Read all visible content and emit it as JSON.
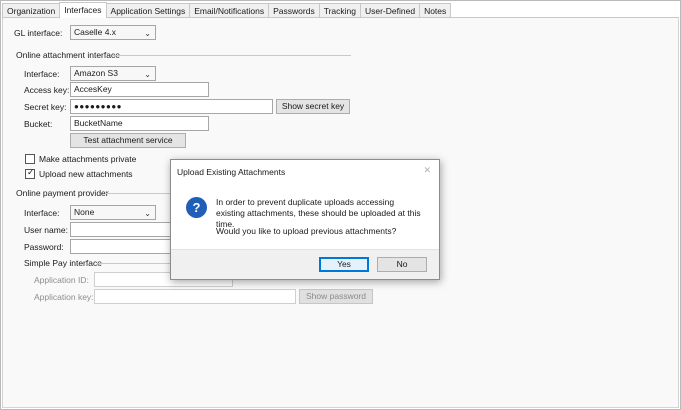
{
  "tabs": [
    "Organization",
    "Interfaces",
    "Application Settings",
    "Email/Notifications",
    "Passwords",
    "Tracking",
    "User-Defined",
    "Notes"
  ],
  "active_tab": "Interfaces",
  "gl": {
    "label": "GL interface:",
    "value": "Caselle 4.x"
  },
  "attachment": {
    "group_title": "Online attachment interface",
    "interface_label": "Interface:",
    "interface_value": "Amazon S3",
    "access_key_label": "Access key:",
    "access_key_value": "AccesKey",
    "secret_key_label": "Secret key:",
    "secret_key_value": "●●●●●●●●●",
    "show_secret_label": "Show secret key",
    "bucket_label": "Bucket:",
    "bucket_value": "BucketName",
    "test_label": "Test attachment service",
    "private_label": "Make attachments private",
    "private_checked": false,
    "upload_label": "Upload new attachments",
    "upload_checked": true
  },
  "payment": {
    "group_title": "Online payment provider",
    "interface_label": "Interface:",
    "interface_value": "None",
    "username_label": "User name:",
    "password_label": "Password:",
    "simple_pay_title": "Simple Pay interface",
    "app_id_label": "Application ID:",
    "app_key_label": "Application key:",
    "show_password_label": "Show password"
  },
  "dialog": {
    "title": "Upload Existing Attachments",
    "message": "In order to prevent duplicate uploads accessing existing attachments, these should be uploaded at this time.",
    "question": "Would you like to upload previous attachments?",
    "yes_label": "Yes",
    "no_label": "No",
    "close_glyph": "✕",
    "icon_glyph": "?"
  },
  "icons": {
    "combo_chevron": "⌄",
    "check": "✓"
  },
  "colors": {
    "question_icon": "#1f5fb7",
    "default_button_border": "#0078d7"
  }
}
